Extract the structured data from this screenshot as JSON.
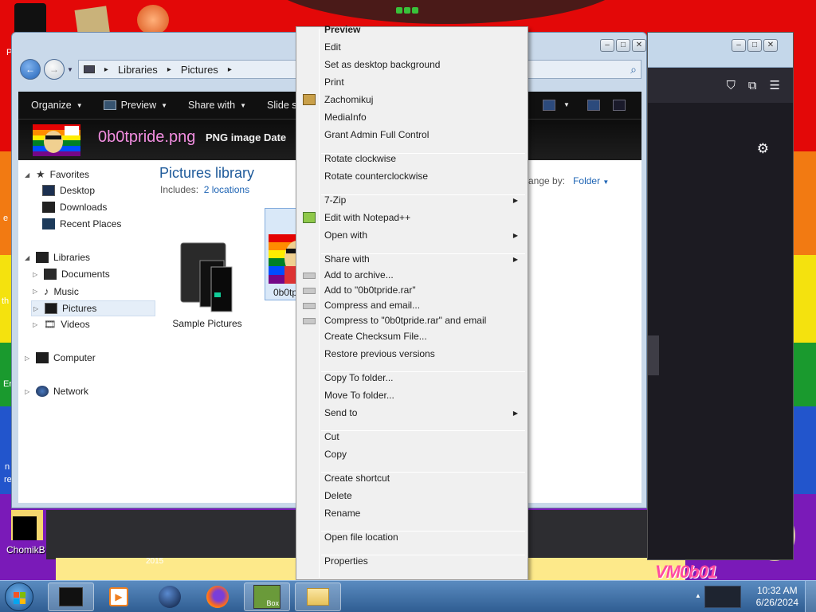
{
  "desktop": {
    "icon_label": "ChomikB",
    "year_text": "2015",
    "vm_text": "VM0b01",
    "edge_fragments": [
      "P",
      "e",
      "th",
      "Er",
      "n",
      "re"
    ]
  },
  "explorer": {
    "breadcrumb": [
      "Libraries",
      "Pictures"
    ],
    "toolbar": {
      "organize": "Organize",
      "preview": "Preview",
      "share_with": "Share with",
      "slideshow": "Slide s"
    },
    "details": {
      "filename": "0b0tpride.png",
      "filetype": "PNG image",
      "date_label": "Date"
    },
    "nav": {
      "favorites": "Favorites",
      "desktop": "Desktop",
      "downloads": "Downloads",
      "recent_places": "Recent Places",
      "libraries": "Libraries",
      "documents": "Documents",
      "music": "Music",
      "pictures": "Pictures",
      "videos": "Videos",
      "computer": "Computer",
      "network": "Network"
    },
    "library": {
      "title": "Pictures library",
      "includes_label": "Includes:",
      "includes_link": "2 locations",
      "arrange_label": "ange by:",
      "arrange_value": "Folder"
    },
    "files": [
      {
        "name": "Sample Pictures"
      },
      {
        "name": "0b0tpri"
      }
    ]
  },
  "context_menu": {
    "items": [
      {
        "label": "Preview",
        "bold": true
      },
      {
        "label": "Edit"
      },
      {
        "label": "Set as desktop background"
      },
      {
        "label": "Print"
      },
      {
        "label": "Zachomikuj",
        "icon": "chomik-icon"
      },
      {
        "label": "MediaInfo"
      },
      {
        "label": "Grant Admin Full Control"
      },
      {
        "label": "Rotate clockwise"
      },
      {
        "label": "Rotate counterclockwise"
      },
      {
        "label": "7-Zip",
        "submenu": true
      },
      {
        "label": "Edit with Notepad++",
        "icon": "notepadpp-icon"
      },
      {
        "label": "Open with",
        "submenu": true
      },
      {
        "label": "Share with",
        "submenu": true
      },
      {
        "label": "Add to archive...",
        "icon": "winrar-icon"
      },
      {
        "label": "Add to \"0b0tpride.rar\"",
        "icon": "winrar-icon"
      },
      {
        "label": "Compress and email...",
        "icon": "winrar-icon"
      },
      {
        "label": "Compress to \"0b0tpride.rar\" and email",
        "icon": "winrar-icon"
      },
      {
        "label": "Create Checksum File..."
      },
      {
        "label": "Restore previous versions"
      },
      {
        "label": "Copy To folder..."
      },
      {
        "label": "Move To folder..."
      },
      {
        "label": "Send to",
        "submenu": true
      },
      {
        "label": "Cut"
      },
      {
        "label": "Copy"
      },
      {
        "label": "Create shortcut"
      },
      {
        "label": "Delete"
      },
      {
        "label": "Rename"
      },
      {
        "label": "Open file location"
      },
      {
        "label": "Properties"
      }
    ],
    "submenu_arrow": "▶"
  },
  "taskbar": {
    "time": "10:32 AM",
    "date": "6/26/2024",
    "box_label": "Box"
  },
  "colors": {
    "explorer_frame": "#c9d9ea",
    "command_bar": "#101010",
    "filename_pink": "#f28ee0",
    "library_title": "#1e5a9a",
    "link_blue": "#1e64b4",
    "taskbar": "#3a6aa3"
  }
}
